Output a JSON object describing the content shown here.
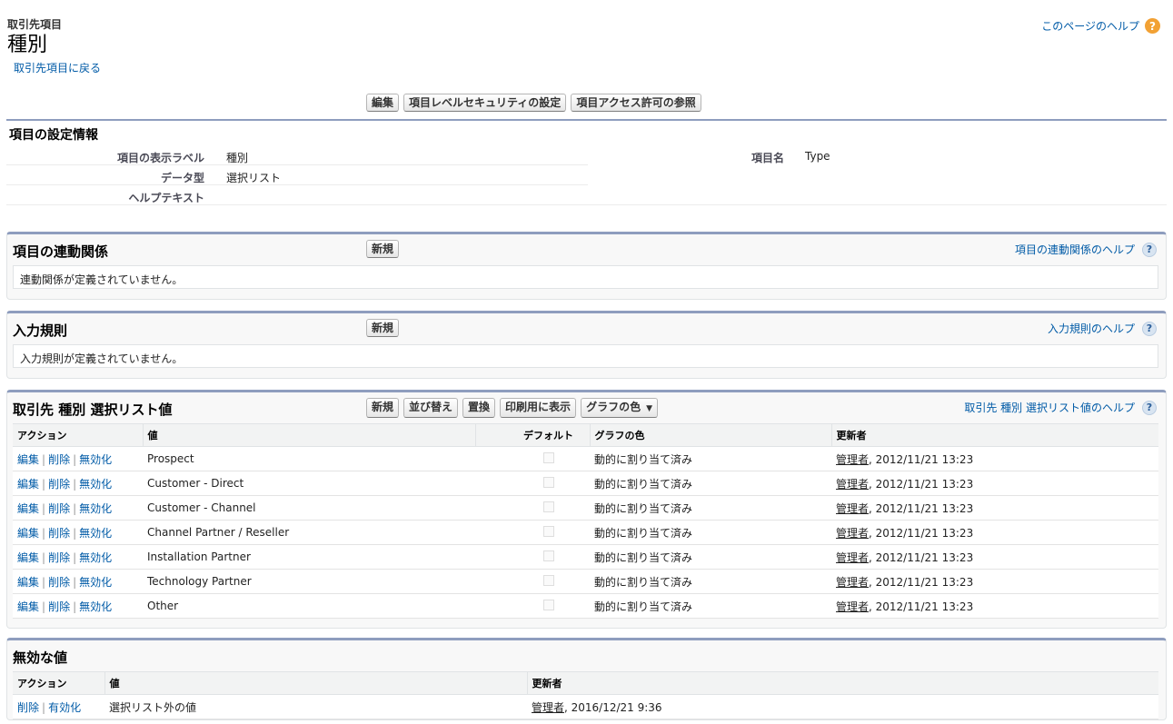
{
  "header": {
    "object_label": "取引先項目",
    "title": "種別",
    "back_link": "取引先項目に戻る",
    "help_link": "このページのヘルプ",
    "help_icon": "?"
  },
  "buttons": {
    "edit": "編集",
    "field_security": "項目レベルセキュリティの設定",
    "view_access": "項目アクセス許可の参照"
  },
  "detail": {
    "section_title": "項目の設定情報",
    "rows": [
      {
        "label": "項目の表示ラベル",
        "value": "種別"
      },
      {
        "label": "データ型",
        "value": "選択リスト"
      },
      {
        "label": "ヘルプテキスト",
        "value": ""
      }
    ],
    "field_name_label": "項目名",
    "field_name_value": "Type"
  },
  "dependencies": {
    "title": "項目の連動関係",
    "new_button": "新規",
    "help_link": "項目の連動関係のヘルプ",
    "empty_message": "連動関係が定義されていません。"
  },
  "validation": {
    "title": "入力規則",
    "new_button": "新規",
    "help_link": "入力規則のヘルプ",
    "empty_message": "入力規則が定義されていません。"
  },
  "picklist": {
    "title": "取引先 種別 選択リスト値",
    "buttons": {
      "new": "新規",
      "reorder": "並び替え",
      "replace": "置換",
      "printable": "印刷用に表示",
      "chart_colors": "グラフの色"
    },
    "help_link": "取引先 種別 選択リスト値のヘルプ",
    "columns": {
      "action": "アクション",
      "value": "値",
      "default": "デフォルト",
      "chart_color": "グラフの色",
      "modified_by": "更新者"
    },
    "action_labels": {
      "edit": "編集",
      "delete": "削除",
      "deactivate": "無効化"
    },
    "rows": [
      {
        "value": "Prospect",
        "color": "動的に割り当て済み",
        "user": "管理者",
        "date": ", 2012/11/21 13:23"
      },
      {
        "value": "Customer - Direct",
        "color": "動的に割り当て済み",
        "user": "管理者",
        "date": ", 2012/11/21 13:23"
      },
      {
        "value": "Customer - Channel",
        "color": "動的に割り当て済み",
        "user": "管理者",
        "date": ", 2012/11/21 13:23"
      },
      {
        "value": "Channel Partner / Reseller",
        "color": "動的に割り当て済み",
        "user": "管理者",
        "date": ", 2012/11/21 13:23"
      },
      {
        "value": "Installation Partner",
        "color": "動的に割り当て済み",
        "user": "管理者",
        "date": ", 2012/11/21 13:23"
      },
      {
        "value": "Technology Partner",
        "color": "動的に割り当て済み",
        "user": "管理者",
        "date": ", 2012/11/21 13:23"
      },
      {
        "value": "Other",
        "color": "動的に割り当て済み",
        "user": "管理者",
        "date": ", 2012/11/21 13:23"
      }
    ]
  },
  "inactive": {
    "title": "無効な値",
    "columns": {
      "action": "アクション",
      "value": "値",
      "modified_by": "更新者"
    },
    "action_labels": {
      "delete": "削除",
      "activate": "有効化"
    },
    "rows": [
      {
        "value": "選択リスト外の値",
        "user": "管理者",
        "date": ", 2016/12/21 9:36"
      }
    ]
  },
  "colors": {
    "link": "#015ba7",
    "section_border": "#8e9dbe",
    "help_orange": "#f2a134"
  }
}
